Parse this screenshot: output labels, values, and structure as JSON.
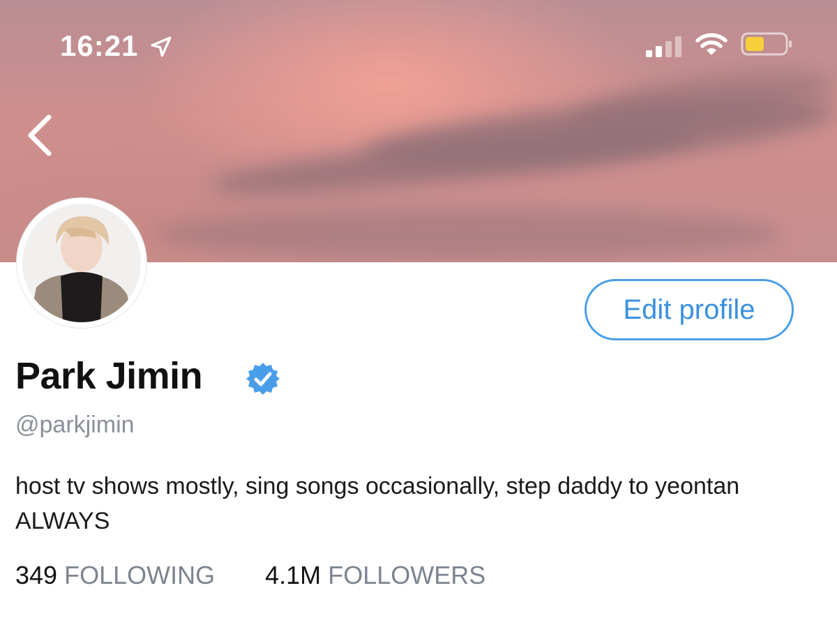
{
  "status_bar": {
    "time": "16:21"
  },
  "profile": {
    "name": "Park Jimin",
    "handle": "@parkjimin",
    "bio": "host tv shows mostly, sing songs occasionally, step daddy to yeontan ALWAYS",
    "edit_label": "Edit profile",
    "following_count": "349",
    "following_label": "FOLLOWING",
    "followers_count": "4.1M",
    "followers_label": "FOLLOWERS"
  },
  "icons": {
    "back": "chevron-left-icon",
    "verified": "verified-badge-icon",
    "location": "location-arrow-icon",
    "signal": "cellular-signal-icon",
    "wifi": "wifi-icon",
    "battery": "battery-icon"
  },
  "colors": {
    "accent": "#4a9ee9",
    "verified": "#4a9ee9",
    "battery_fill": "#f6cf3a",
    "muted_text": "#7b8490"
  }
}
